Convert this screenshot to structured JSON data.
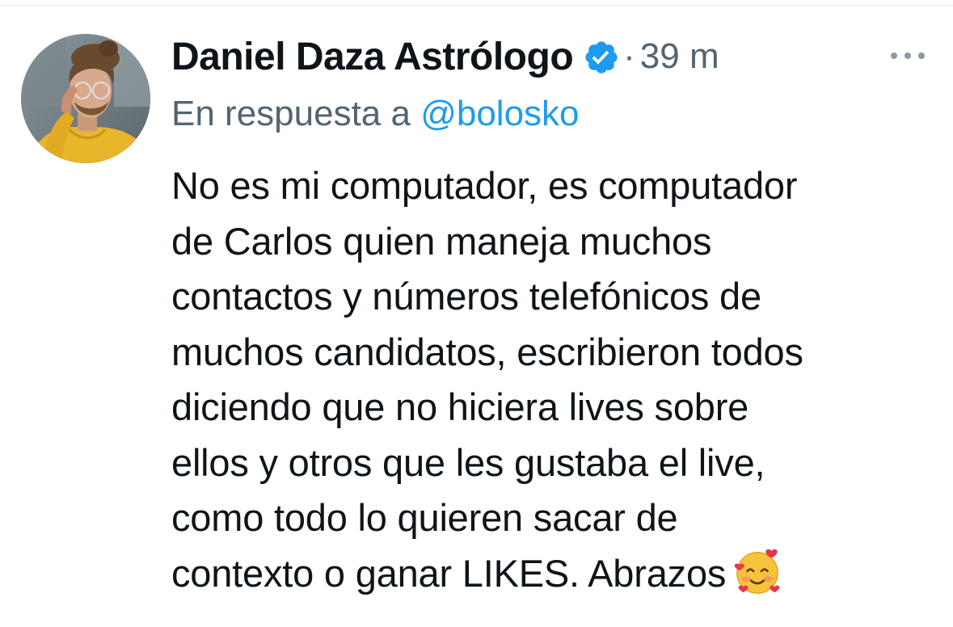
{
  "tweet": {
    "author": {
      "display_name": "Daniel Daza Astrólogo",
      "verified_icon": "verified-badge-icon",
      "separator": "·",
      "timestamp": "39 m"
    },
    "more_icon": "more-horizontal-icon",
    "reply_to": {
      "prefix": "En respuesta a ",
      "handle": "@bolosko"
    },
    "text_lines": [
      "No es mi computador, es computador",
      "de Carlos quien maneja muchos",
      "contactos y números telefónicos de",
      "muchos candidatos, escribieron todos",
      "diciendo que no hiciera lives sobre",
      "ellos y otros que les gustaba el live,",
      "como todo lo quieren sacar de",
      "contexto o ganar LIKES. Abrazos"
    ],
    "emoji": "smiling-face-with-hearts-icon"
  },
  "colors": {
    "text_primary": "#0f1419",
    "text_secondary": "#536471",
    "accent": "#1d9bf0",
    "divider": "#e6ecf0"
  }
}
